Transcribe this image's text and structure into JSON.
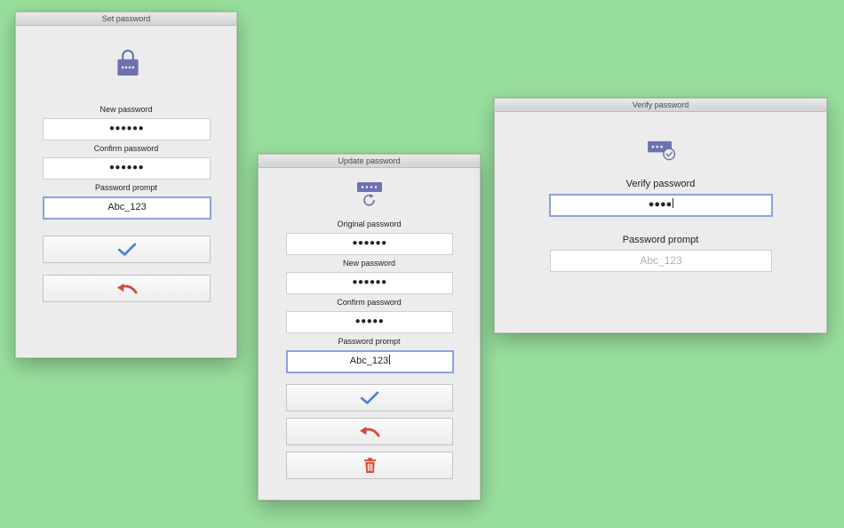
{
  "set_window": {
    "title": "Set password",
    "icon": "lock-icon",
    "new_label": "New password",
    "new_value": "●●●●●●",
    "confirm_label": "Confirm password",
    "confirm_value": "●●●●●●",
    "prompt_label": "Password prompt",
    "prompt_value": "Abc_123",
    "buttons": [
      "confirm-check-icon",
      "undo-arrow-icon"
    ]
  },
  "update_window": {
    "title": "Update password",
    "icon": "password-refresh-icon",
    "original_label": "Original password",
    "original_value": "●●●●●●",
    "new_label": "New password",
    "new_value": "●●●●●●",
    "confirm_label": "Confirm password",
    "confirm_value": "●●●●●",
    "prompt_label": "Password prompt",
    "prompt_value": "Abc_123",
    "buttons": [
      "confirm-check-icon",
      "undo-arrow-icon",
      "trash-icon"
    ]
  },
  "verify_window": {
    "title": "Verify password",
    "icon": "password-verified-icon",
    "verify_label": "Verify password",
    "verify_value": "●●●●",
    "prompt_label": "Password prompt",
    "prompt_placeholder": "Abc_123"
  },
  "colors": {
    "background": "#98df9d",
    "icon_purple": "#6e72b0",
    "check_blue": "#4a7fd9",
    "undo_red": "#d4483c",
    "focus_ring": "#8aa3db"
  }
}
